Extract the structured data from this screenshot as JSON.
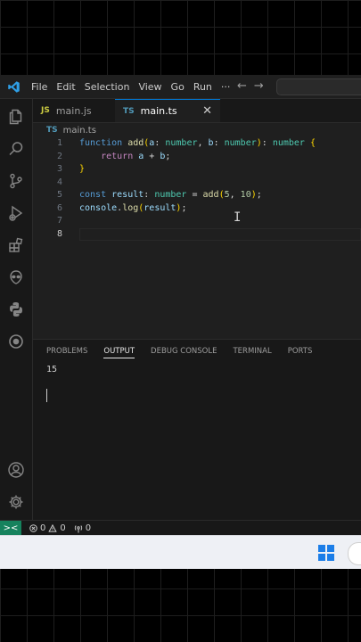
{
  "titlebar": {
    "menus": [
      "File",
      "Edit",
      "Selection",
      "View",
      "Go",
      "Run",
      "···"
    ],
    "back": "←",
    "forward": "→"
  },
  "tabs": [
    {
      "badge": "JS",
      "label": "main.js"
    },
    {
      "badge": "TS",
      "label": "main.ts",
      "close": "✕"
    }
  ],
  "breadcrumb": {
    "badge": "TS",
    "file": "main.ts"
  },
  "editor": {
    "line_numbers": [
      "1",
      "2",
      "3",
      "4",
      "5",
      "6",
      "7",
      "8"
    ],
    "lines": [
      "function add(a: number, b: number): number {",
      "    return a + b;",
      "}",
      "",
      "const result: number = add(5, 10);",
      "console.log(result);",
      "",
      ""
    ]
  },
  "panel": {
    "tabs": [
      "PROBLEMS",
      "OUTPUT",
      "DEBUG CONSOLE",
      "TERMINAL",
      "PORTS"
    ],
    "active_tab": "OUTPUT",
    "output": "15"
  },
  "statusbar": {
    "remote": "><",
    "errors": "0",
    "warnings": "0",
    "ports": "0"
  },
  "colors": {
    "accent": "#0078d4",
    "remote": "#16825d",
    "ts_badge": "#519aba",
    "js_badge": "#cbcb41"
  },
  "icons": [
    "vscode-logo-icon",
    "explorer-icon",
    "search-icon",
    "source-control-icon",
    "run-debug-icon",
    "extensions-icon",
    "alien-icon",
    "python-icon",
    "remote-icon",
    "account-icon",
    "settings-gear-icon",
    "windows-start-icon"
  ]
}
